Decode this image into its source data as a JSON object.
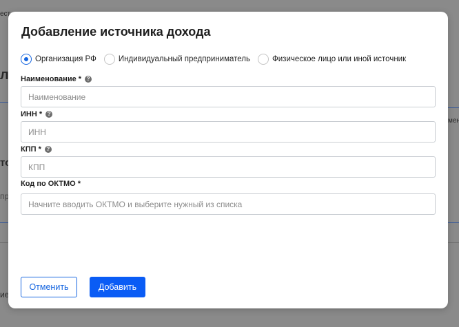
{
  "background": {
    "frag_top": "ест",
    "frag_pa": "ла",
    "frag_ment": "мент",
    "frag_to": "то",
    "frag_pr": "пр",
    "frag_bottom": "ие"
  },
  "dialog": {
    "title": "Добавление источника дохода",
    "radio_options": [
      {
        "label": "Организация РФ",
        "checked": true
      },
      {
        "label": "Индивидуальный предприниматель",
        "checked": false
      },
      {
        "label": "Физическое лицо или иной источник",
        "checked": false
      }
    ],
    "fields": {
      "name": {
        "label": "Наименование *",
        "placeholder": "Наименование",
        "value": ""
      },
      "inn": {
        "label": "ИНН *",
        "placeholder": "ИНН",
        "value": ""
      },
      "kpp": {
        "label": "КПП *",
        "placeholder": "КПП",
        "value": ""
      },
      "oktmo": {
        "label": "Код по ОКТМО *",
        "placeholder": "Начните вводить ОКТМО и выберите нужный из списка",
        "value": ""
      }
    },
    "help_glyph": "?",
    "buttons": {
      "cancel": "Отменить",
      "add": "Добавить"
    }
  },
  "colors": {
    "accent": "#0a5cf5",
    "overlay": "#808080",
    "radio_checked": "#1565e0"
  }
}
